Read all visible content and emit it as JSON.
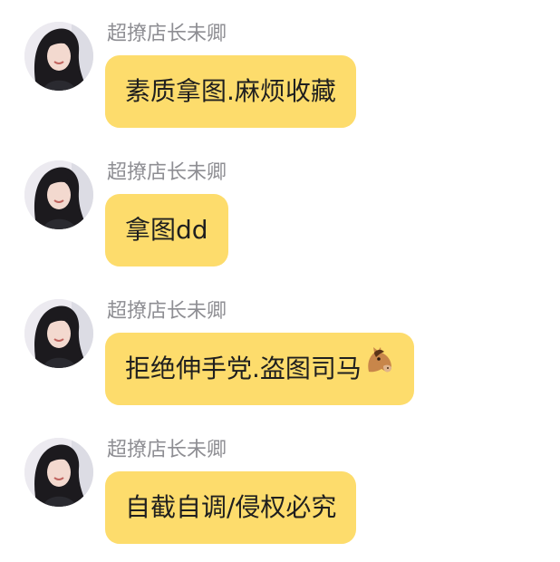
{
  "messages": [
    {
      "sender": "超撩店长未卿",
      "text": "素质拿图.麻烦收藏"
    },
    {
      "sender": "超撩店长未卿",
      "text": "拿图dd"
    },
    {
      "sender": "超撩店长未卿",
      "text": "拒绝伸手党.盗图司马",
      "emoji": "horse-face-icon"
    },
    {
      "sender": "超撩店长未卿",
      "text": "自截自调/侵权必究"
    }
  ],
  "colors": {
    "bubble": "#fddc6c",
    "sender_text": "#8e8e93",
    "message_text": "#1f1f1f"
  }
}
